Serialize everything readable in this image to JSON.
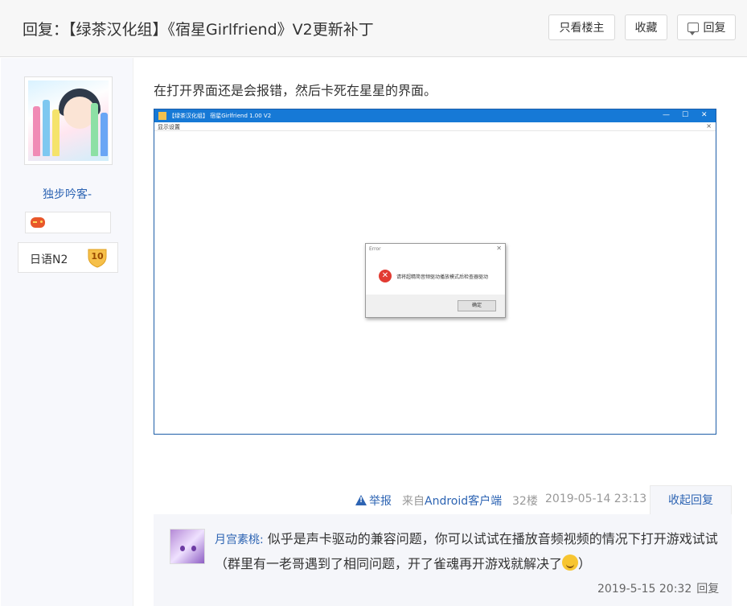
{
  "header": {
    "title": "回复：【绿茶汉化组】《宿星Girlfriend》V2更新补丁",
    "only_op_label": "只看楼主",
    "favorite_label": "收藏",
    "reply_label": "回复"
  },
  "author": {
    "username": "独步吟客-",
    "level_name": "日语N2",
    "level_number": "10",
    "badge_icon": "gamepad-icon"
  },
  "post": {
    "text": "在打开界面还是会报错，然后卡死在星星的界面。",
    "screenshot": {
      "window_title": "【绿茶汉化组】 宿星Girlfriend 1.00 V2",
      "menu_label": "显示设置",
      "controls": [
        "—",
        "☐",
        "✕"
      ],
      "menu_close": "×",
      "dialog": {
        "title": "Error",
        "close": "✕",
        "message": "请将超精简音频驱动播放模式后检查器驱动",
        "ok_label": "确定"
      }
    },
    "footer": {
      "report_label": "举报",
      "from_prefix": "来自",
      "from_client": "Android客户端",
      "floor": "32楼",
      "date": "2019-05-14 23:13",
      "collapse_label": "收起回复"
    }
  },
  "subreply": {
    "username": "月宫素桃:",
    "text": " 似乎是声卡驱动的兼容问题，你可以试试在播放音频视频的情况下打开游戏试试（群里有一老哥遇到了相同问题，开了雀魂再开游戏就解决了",
    "text_end": "）",
    "emoji": "smile-emoji",
    "date": "2019-5-15 20:32",
    "reply_label": "回复"
  }
}
